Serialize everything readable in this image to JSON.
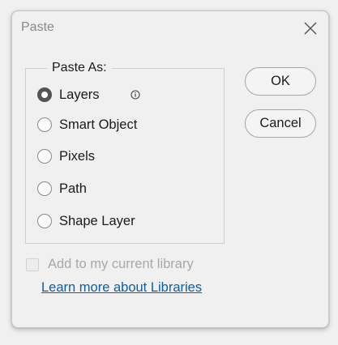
{
  "dialog": {
    "title": "Paste"
  },
  "paste_as": {
    "legend": "Paste As:",
    "options": [
      {
        "label": "Layers",
        "checked": true
      },
      {
        "label": "Smart Object",
        "checked": false
      },
      {
        "label": "Pixels",
        "checked": false
      },
      {
        "label": "Path",
        "checked": false
      },
      {
        "label": "Shape Layer",
        "checked": false
      }
    ]
  },
  "buttons": {
    "ok_label": "OK",
    "cancel_label": "Cancel"
  },
  "library": {
    "checkbox_label": "Add to my current library",
    "checked": false,
    "enabled": false,
    "link_label": "Learn more about Libraries"
  },
  "colors": {
    "link": "#0b5fa8",
    "disabled_text": "#a8a8a8"
  },
  "icons": {
    "close": "close-icon",
    "info": "info-icon"
  }
}
